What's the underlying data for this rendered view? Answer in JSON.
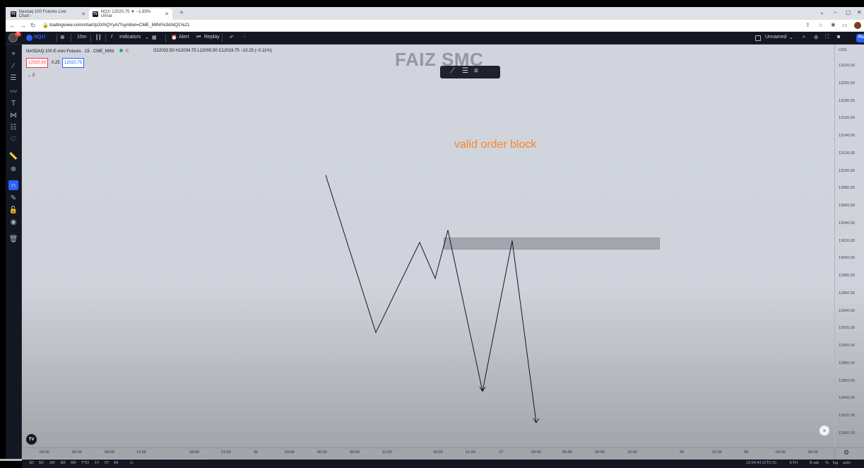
{
  "browser": {
    "tabs": [
      {
        "title": "Nasdaq 100 Futures Live Chart -",
        "active": false
      },
      {
        "title": "NQ1! 12020.75 ▼ −1.65% Unnar",
        "active": true
      }
    ],
    "url": "tradingview.com/chart/p3XhQYyA/?symbol=CME_MINI%3ANQ1%21"
  },
  "toolbar": {
    "badge": "11",
    "symbol": "NQ1!",
    "interval": "15m",
    "indicators_label": "Indicators",
    "alert_label": "Alert",
    "replay_label": "Replay",
    "layout_name": "Unnamed",
    "publish_label": "Publi"
  },
  "legend": {
    "title": "NASDAQ 100 E-mini Futures · 15 · CME_MINI",
    "status": "R",
    "ohlc": "O12032.50 H12034.75 L12005.50 C12019.75 −13.25 (−0.11%)",
    "bid": "12020.50",
    "spread": "0.25",
    "ask": "12020.75",
    "collapsed_count": "2"
  },
  "watermark": "FAIZ SMC",
  "annotation": {
    "text": "valid order block",
    "color": "#f7862a"
  },
  "price_axis": {
    "currency": "USD",
    "ticks": [
      "13220.00",
      "13200.00",
      "13180.00",
      "13160.00",
      "13140.00",
      "13120.00",
      "13100.00",
      "13080.00",
      "13060.00",
      "13040.00",
      "13020.00",
      "13000.00",
      "12980.00",
      "12960.00",
      "12940.00",
      "12920.00",
      "12900.00",
      "12880.00",
      "12860.00",
      "12840.00",
      "12820.00",
      "12800.00"
    ]
  },
  "time_axis": {
    "ticks": [
      "03:00",
      "06:00",
      "09:00",
      "12:00",
      "18:00",
      "21:00",
      "26",
      "03:00",
      "06:00",
      "09:00",
      "12:00",
      "18:00",
      "21:00",
      "27",
      "03:00",
      "06:00",
      "09:00",
      "12:00",
      "29",
      "21:00",
      "30",
      "03:00",
      "06:00"
    ]
  },
  "bottom_bar": {
    "ranges": [
      "1D",
      "5D",
      "1M",
      "3M",
      "6M",
      "YTD",
      "1Y",
      "5Y",
      "All"
    ],
    "clock": "13:04:43 (UTC-5)",
    "session": "ETH",
    "adj": "B-adj",
    "percent": "%",
    "log": "log",
    "auto": "auto"
  },
  "drawing": {
    "type": "line",
    "x": [
      "25 08:30",
      "25 16:00",
      "25 22:00",
      "26 01:00",
      "26 02:00",
      "26 04:00",
      "26 08:00",
      "26 13:00"
    ],
    "y": [
      13095,
      12915,
      13018,
      12977,
      13032,
      12848,
      13020,
      12812
    ],
    "order_block": {
      "low": 13010,
      "high": 13024
    }
  },
  "colors": {
    "accent": "#2962ff",
    "toolbar_bg": "#131722",
    "negative": "#f23645"
  }
}
